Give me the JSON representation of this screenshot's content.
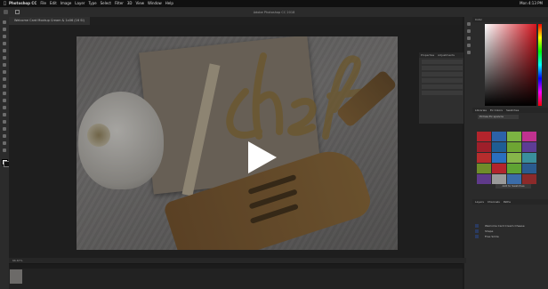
{
  "menubar": {
    "app_name": "Photoshop CC",
    "items": [
      "File",
      "Edit",
      "Image",
      "Layer",
      "Type",
      "Select",
      "Filter",
      "3D",
      "View",
      "Window",
      "Help"
    ],
    "status": [
      "Mon 4:13 PM"
    ]
  },
  "window": {
    "title": "Adobe Photoshop CC 2018"
  },
  "document": {
    "tab_label": "Welcome Card Mockup Cream & 1x06 (16 SI)"
  },
  "properties_panel": {
    "tabs": [
      "Properties",
      "Adjustments"
    ]
  },
  "right_panel": {
    "top_tabs": [
      "Color"
    ],
    "swatch_tabs": [
      "Libraries",
      "Ex Colors",
      "Swatches"
    ],
    "swatch_select": "Pirmas Ex spalvos",
    "swatch_button": "Add to Swatches",
    "swatches": [
      "#b3242c",
      "#2c62a8",
      "#7cb342",
      "#c0328f",
      "#9e1f2a",
      "#1f5d94",
      "#6ea533",
      "#5d3d95",
      "#b62d2d",
      "#2a6fbf",
      "#86b54a",
      "#3a8f9c",
      "#6f8d2a",
      "#b3242c",
      "#5fa333",
      "#2b5b8f",
      "#5f3a8a",
      "#9a9a9a",
      "#3b6ca8",
      "#8c2a2a"
    ],
    "layer_tabs": [
      "Layers",
      "Channels",
      "Paths"
    ],
    "layers": [
      {
        "name": "Welcome Card Cream Cheese",
        "selected": false
      },
      {
        "name": "Shape",
        "selected": false
      },
      {
        "name": "Free Smile",
        "selected": false
      }
    ]
  },
  "statusbar": {
    "text": "66.67%"
  },
  "colors": {
    "play_button": "#ffffff",
    "foreground": "#f0f0f0",
    "background": "#111111"
  }
}
